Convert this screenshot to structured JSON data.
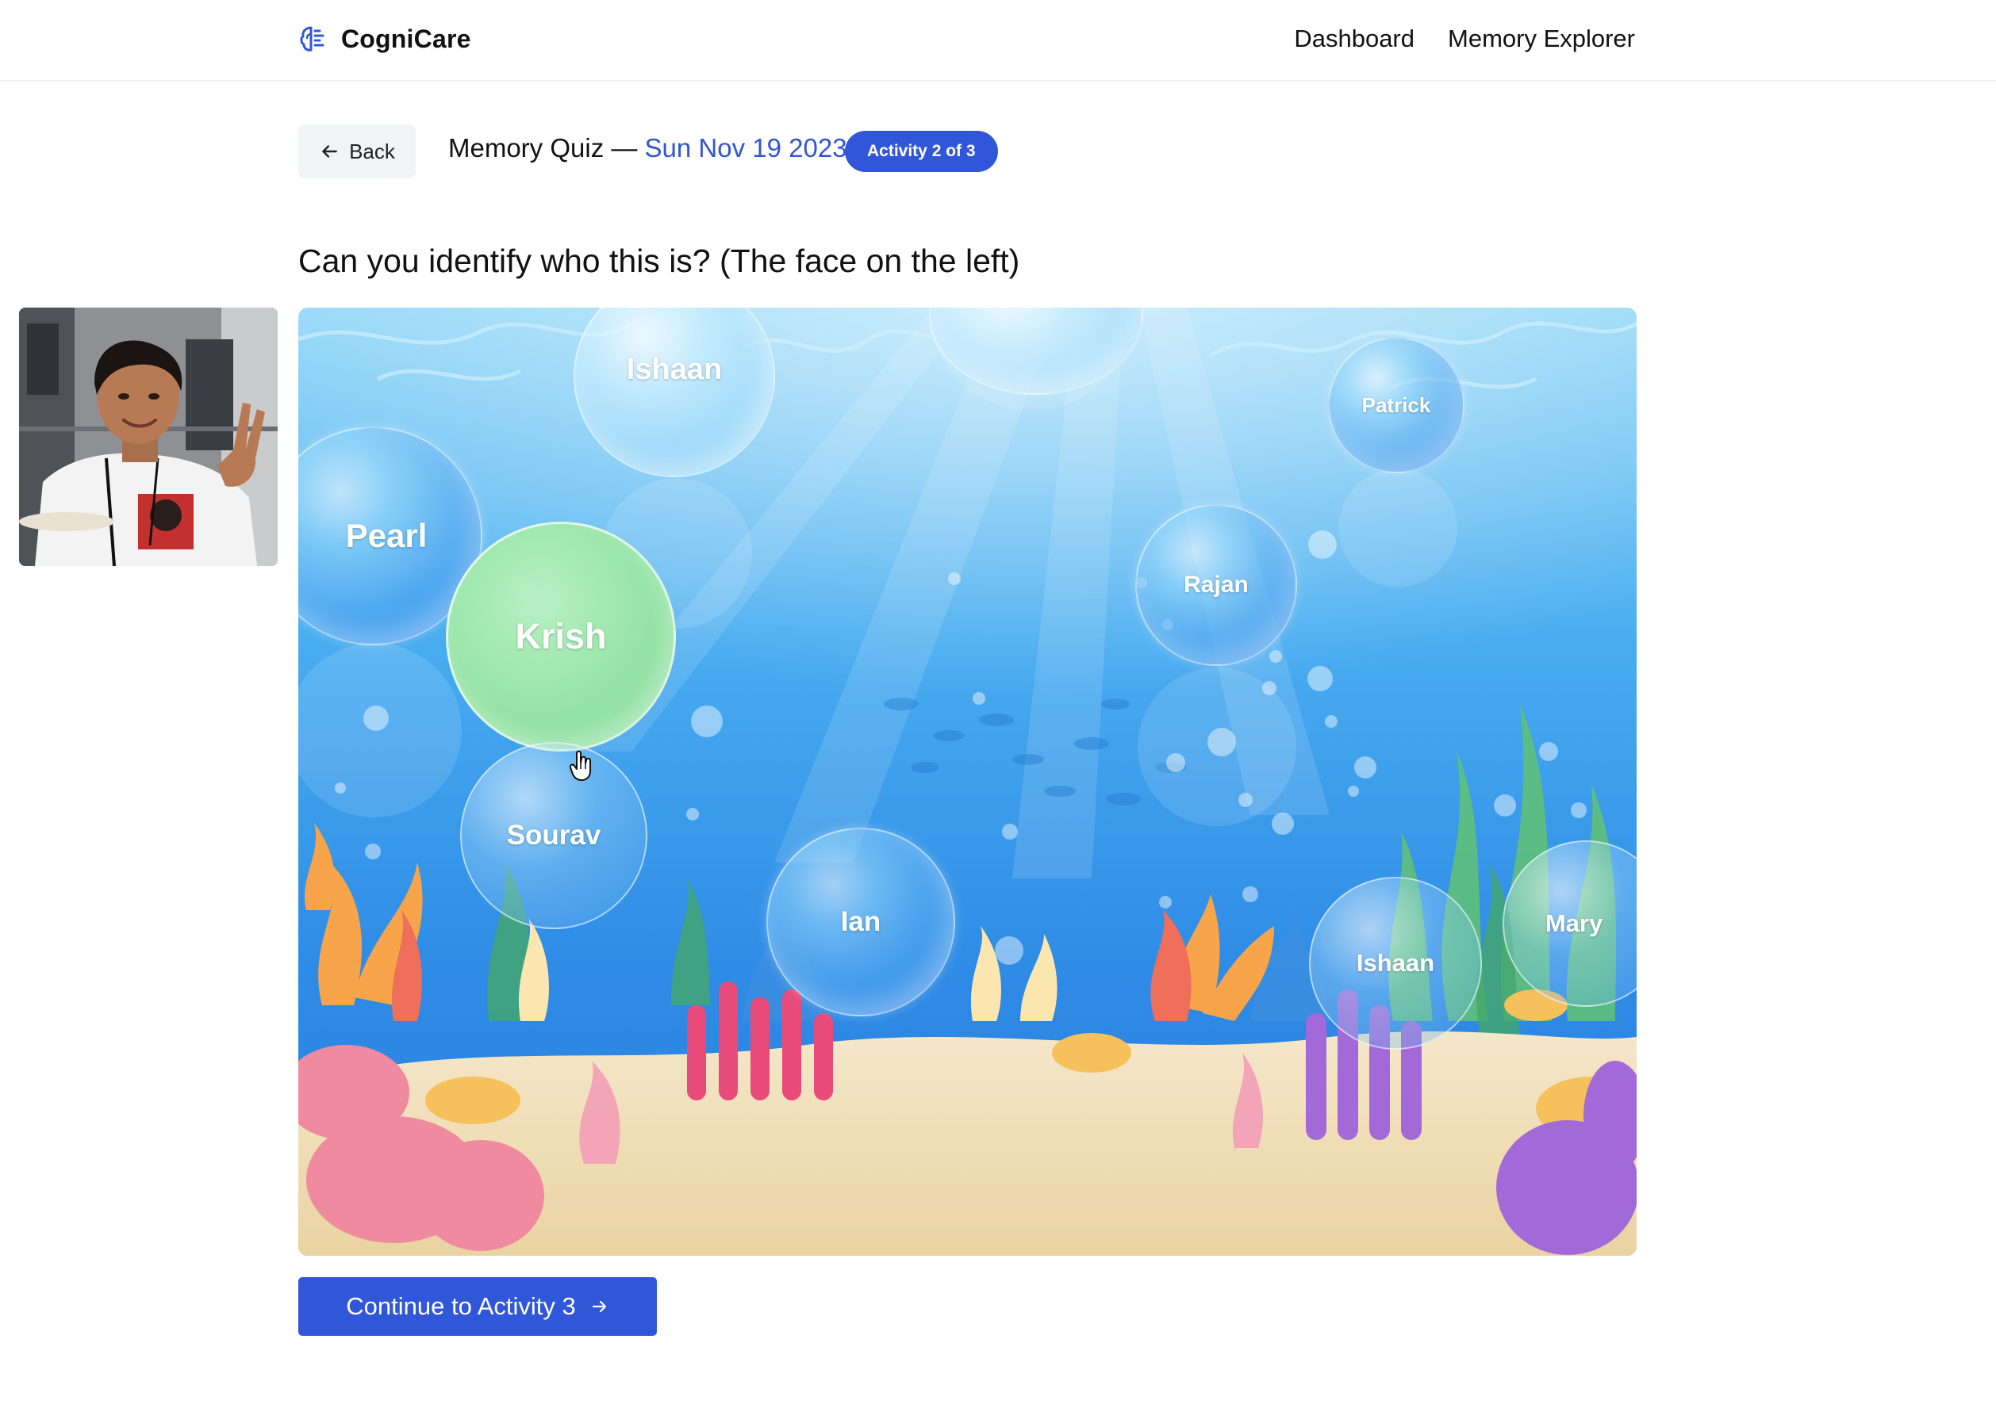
{
  "app": {
    "name": "CogniCare"
  },
  "nav": {
    "dashboard": "Dashboard",
    "memory_explorer": "Memory Explorer"
  },
  "header": {
    "back_label": "Back",
    "quiz_label": "Memory Quiz —",
    "quiz_date": "Sun Nov 19 2023",
    "activity_badge": "Activity 2 of 3"
  },
  "question": "Can you identify who this is? (The face on the left)",
  "bubbles": {
    "ishaan_top": "Ishaan",
    "patrick": "Patrick",
    "pearl": "Pearl",
    "krish": "Krish",
    "rajan": "Rajan",
    "sourav": "Sourav",
    "ian": "Ian",
    "ishaan_bottom": "Ishaan",
    "mary": "Mary"
  },
  "selected_bubble": "Krish",
  "continue_label": "Continue to Activity 3",
  "icons": {
    "brand": "brain-logo-icon",
    "back": "arrow-left-icon",
    "continue": "arrow-right-icon",
    "cursor": "hand-pointer-icon"
  },
  "colors": {
    "primary": "#3157d9",
    "date_accent": "#3155d6",
    "selected_bubble": "#9ae6ab",
    "water": "#3aa0ee"
  }
}
